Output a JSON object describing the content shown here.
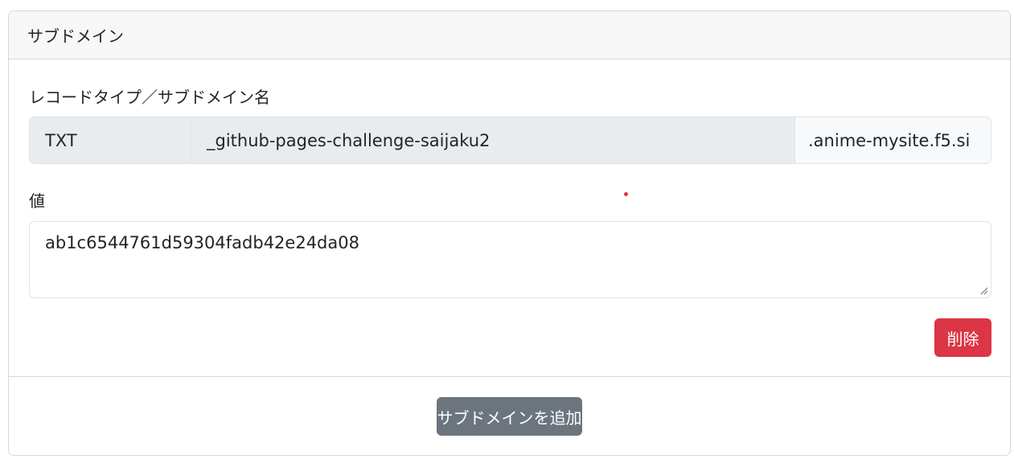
{
  "card": {
    "title": "サブドメイン"
  },
  "record": {
    "label": "レコードタイプ／サブドメイン名",
    "type": "TXT",
    "subdomain": "_github-pages-challenge-saijaku2",
    "suffix": ".anime-mysite.f5.si"
  },
  "value": {
    "label": "値",
    "text": "ab1c6544761d59304fadb42e24da08"
  },
  "buttons": {
    "delete": "削除",
    "add": "サブドメインを追加"
  },
  "colors": {
    "danger": "#dc3545",
    "secondary": "#6c757d"
  }
}
